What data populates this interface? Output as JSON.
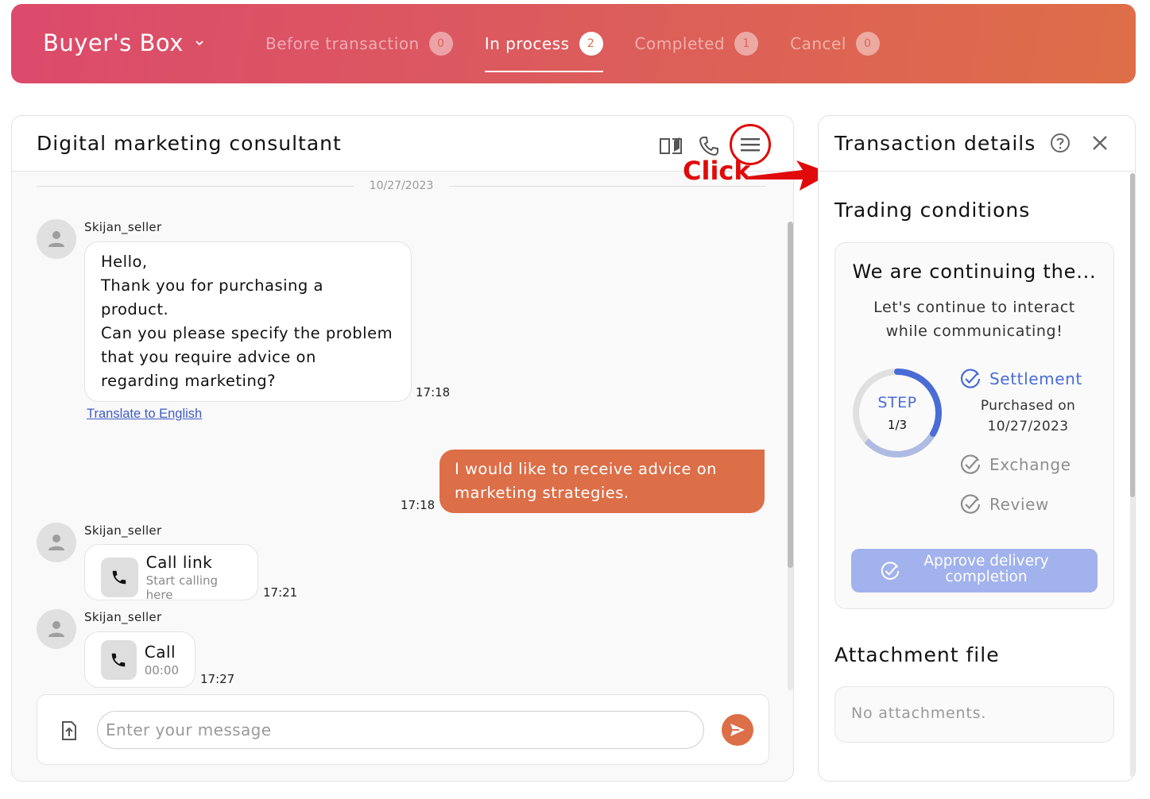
{
  "header": {
    "brand": "Buyer's Box",
    "tabs": [
      {
        "label": "Before transaction",
        "count": "0",
        "active": false
      },
      {
        "label": "In process",
        "count": "2",
        "active": true
      },
      {
        "label": "Completed",
        "count": "1",
        "active": false
      },
      {
        "label": "Cancel",
        "count": "0",
        "active": false
      }
    ]
  },
  "chat": {
    "title": "Digital marketing consultant",
    "header_icons": [
      "book-open-icon",
      "phone-icon",
      "menu-icon"
    ],
    "date_separator": "10/27/2023",
    "messages": [
      {
        "sender": "Skijan_seller",
        "lines": [
          "Hello,",
          "Thank you for purchasing a",
          "product.",
          "Can you please specify the problem",
          "that you require advice on",
          "regarding marketing?"
        ],
        "time": "17:18",
        "translate_link": "Translate to English"
      },
      {
        "mine": true,
        "lines": [
          "I would like to receive advice on",
          "marketing strategies."
        ],
        "time": "17:18"
      },
      {
        "sender": "Skijan_seller",
        "call_title": "Call link",
        "call_sub": "Start calling here",
        "time": "17:21"
      },
      {
        "sender": "Skijan_seller",
        "call_title": "Call",
        "call_sub": "00:00",
        "time": "17:27"
      }
    ],
    "composer": {
      "placeholder": "Enter your message",
      "value": ""
    }
  },
  "annotation": {
    "label": "Click",
    "color": "#e00a0a"
  },
  "details": {
    "title": "Transaction details",
    "trading_conditions_title": "Trading conditions",
    "card_heading": "We are continuing the...",
    "card_sub_lines": [
      "Let's continue to interact",
      "while communicating!"
    ],
    "step_label": "STEP",
    "step_count": "1/3",
    "step_progress": 0.333,
    "steps": [
      {
        "label": "Settlement",
        "active": true,
        "note_lines": [
          "Purchased on",
          "10/27/2023"
        ]
      },
      {
        "label": "Exchange",
        "active": false
      },
      {
        "label": "Review",
        "active": false
      }
    ],
    "approve_button_lines": [
      "Approve delivery",
      "completion"
    ],
    "attachment_title": "Attachment file",
    "attachment_empty": "No attachments."
  },
  "colors": {
    "accent_orange": "#dc6e48",
    "accent_pink": "#dc4a6c",
    "step_blue": "#4a6cd6",
    "approve_disabled": "#a1b2ec"
  }
}
